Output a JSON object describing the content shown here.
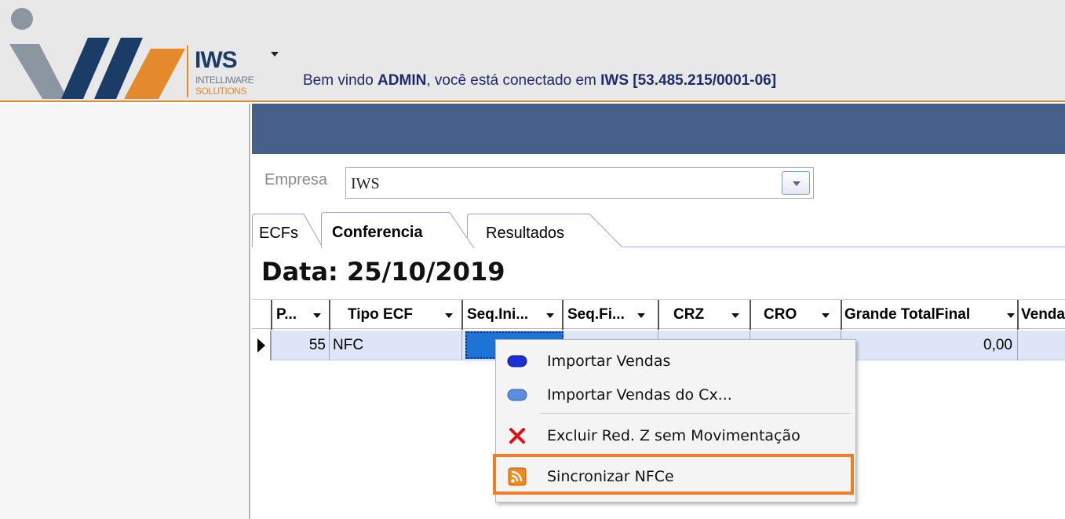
{
  "header": {
    "brand": "IWS",
    "brand_line1": "INTELLIWARE",
    "brand_line2": "SOLUTIONS",
    "welcome_prefix": "Bem vindo ",
    "user": "ADMIN",
    "welcome_middle": ", você está conectado em ",
    "company": "IWS [53.485.215/0001-06]",
    "colors": {
      "navy": "#1b3c66",
      "orange": "#e58a2c",
      "band": "#47608a"
    }
  },
  "empresa": {
    "label": "Empresa",
    "value": "IWS"
  },
  "tabs": [
    {
      "label": "ECFs"
    },
    {
      "label": "Conferencia",
      "active": true
    },
    {
      "label": "Resultados"
    }
  ],
  "data_title": "Data: 25/10/2019",
  "grid": {
    "columns": [
      "P...",
      "Tipo ECF",
      "Seq.Ini...",
      "Seq.Fi...",
      "CRZ",
      "CRO",
      "Grande TotalFinal",
      "Venda"
    ],
    "rows": [
      {
        "p": "55",
        "tipo": "NFC",
        "seq_ini": "",
        "seq_fi": "",
        "crz": "",
        "cro": "",
        "grande_total": "0,00",
        "venda": ""
      }
    ]
  },
  "context_menu": {
    "items": [
      {
        "label": "Importar Vendas",
        "icon": "blue-capsule-icon"
      },
      {
        "label": "Importar Vendas do Cx...",
        "icon": "light-blue-capsule-icon"
      },
      {
        "label": "Excluir Red. Z sem Movimentação",
        "icon": "red-x-icon"
      },
      {
        "label": "Sincronizar NFCe",
        "icon": "rss-feed-icon",
        "highlighted": true
      }
    ]
  }
}
